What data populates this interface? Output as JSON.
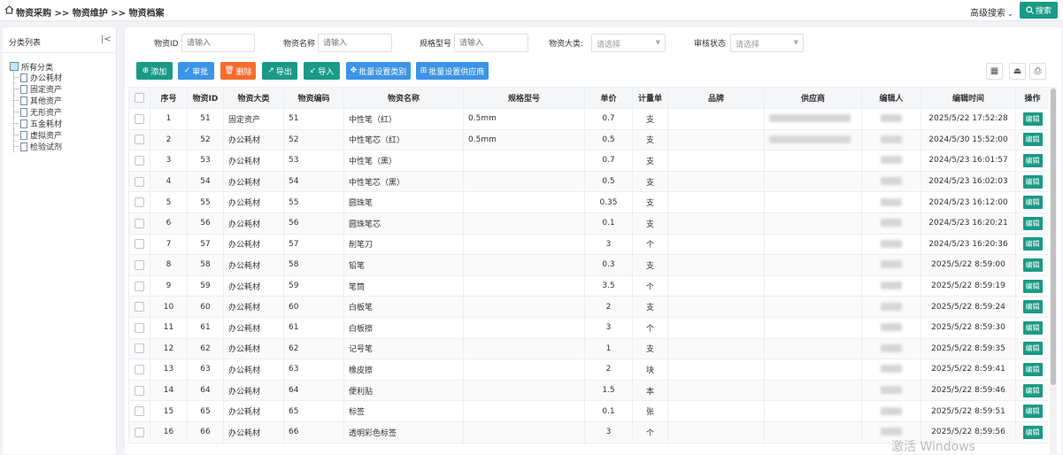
{
  "breadcrumb": "物资采购 >> 物资维护 >> 物资档案",
  "header": {
    "advanced_search": "高级搜索",
    "search_button": "搜索"
  },
  "sidebar": {
    "title": "分类列表",
    "root": "所有分类",
    "items": [
      {
        "label": "办公耗材"
      },
      {
        "label": "固定资产"
      },
      {
        "label": "其他资产"
      },
      {
        "label": "无形资产"
      },
      {
        "label": "五金耗材"
      },
      {
        "label": "虚拟资产"
      },
      {
        "label": "检验试剂"
      }
    ]
  },
  "filters": {
    "id_label": "物资ID",
    "id_placeholder": "请输入",
    "name_label": "物资名称",
    "name_placeholder": "请输入",
    "spec_label": "规格型号",
    "spec_placeholder": "请输入",
    "category_label": "物资大类:",
    "category_placeholder": "请选择",
    "status_label": "审核状态",
    "status_placeholder": "请选择"
  },
  "toolbar": {
    "add": "添加",
    "approve": "审批",
    "delete": "删除",
    "export": "导出",
    "import": "导入",
    "batch_category": "批量设置类别",
    "batch_supplier": "批量设置供应商"
  },
  "table": {
    "headers": [
      "序号",
      "物资ID",
      "物资大类",
      "物资编码",
      "物资名称",
      "规格型号",
      "单价",
      "计量单",
      "品牌",
      "供应商",
      "编辑人",
      "编辑时间",
      "操作"
    ],
    "edit_label": "编辑",
    "rows": [
      {
        "no": "1",
        "id": "51",
        "category": "固定资产",
        "code": "51",
        "name": "中性笔（红）",
        "spec": "0.5mm",
        "price": "0.7",
        "unit": "支",
        "time": "2025/5/22 17:52:28"
      },
      {
        "no": "2",
        "id": "52",
        "category": "办公耗材",
        "code": "52",
        "name": "中性笔芯（红）",
        "spec": "0.5mm",
        "price": "0.5",
        "unit": "支",
        "time": "2024/5/30 15:52:00"
      },
      {
        "no": "3",
        "id": "53",
        "category": "办公耗材",
        "code": "53",
        "name": "中性笔（黑）",
        "spec": "",
        "price": "0.7",
        "unit": "支",
        "time": "2024/5/23 16:01:57"
      },
      {
        "no": "4",
        "id": "54",
        "category": "办公耗材",
        "code": "54",
        "name": "中性笔芯（黑）",
        "spec": "",
        "price": "0.5",
        "unit": "支",
        "time": "2024/5/23 16:02:03"
      },
      {
        "no": "5",
        "id": "55",
        "category": "办公耗材",
        "code": "55",
        "name": "圆珠笔",
        "spec": "",
        "price": "0.35",
        "unit": "支",
        "time": "2024/5/23 16:12:00"
      },
      {
        "no": "6",
        "id": "56",
        "category": "办公耗材",
        "code": "56",
        "name": "圆珠笔芯",
        "spec": "",
        "price": "0.1",
        "unit": "支",
        "time": "2024/5/23 16:20:21"
      },
      {
        "no": "7",
        "id": "57",
        "category": "办公耗材",
        "code": "57",
        "name": "削笔刀",
        "spec": "",
        "price": "3",
        "unit": "个",
        "time": "2024/5/23 16:20:36"
      },
      {
        "no": "8",
        "id": "58",
        "category": "办公耗材",
        "code": "58",
        "name": "铅笔",
        "spec": "",
        "price": "0.3",
        "unit": "支",
        "time": "2025/5/22 8:59:00"
      },
      {
        "no": "9",
        "id": "59",
        "category": "办公耗材",
        "code": "59",
        "name": "笔筒",
        "spec": "",
        "price": "3.5",
        "unit": "个",
        "time": "2025/5/22 8:59:19"
      },
      {
        "no": "10",
        "id": "60",
        "category": "办公耗材",
        "code": "60",
        "name": "白板笔",
        "spec": "",
        "price": "2",
        "unit": "支",
        "time": "2025/5/22 8:59:24"
      },
      {
        "no": "11",
        "id": "61",
        "category": "办公耗材",
        "code": "61",
        "name": "白板擦",
        "spec": "",
        "price": "3",
        "unit": "个",
        "time": "2025/5/22 8:59:30"
      },
      {
        "no": "12",
        "id": "62",
        "category": "办公耗材",
        "code": "62",
        "name": "记号笔",
        "spec": "",
        "price": "1",
        "unit": "支",
        "time": "2025/5/22 8:59:35"
      },
      {
        "no": "13",
        "id": "63",
        "category": "办公耗材",
        "code": "63",
        "name": "橡皮擦",
        "spec": "",
        "price": "2",
        "unit": "块",
        "time": "2025/5/22 8:59:41"
      },
      {
        "no": "14",
        "id": "64",
        "category": "办公耗材",
        "code": "64",
        "name": "便利贴",
        "spec": "",
        "price": "1.5",
        "unit": "本",
        "time": "2025/5/22 8:59:46"
      },
      {
        "no": "15",
        "id": "65",
        "category": "办公耗材",
        "code": "65",
        "name": "标签",
        "spec": "",
        "price": "0.1",
        "unit": "张",
        "time": "2025/5/22 8:59:51"
      },
      {
        "no": "16",
        "id": "66",
        "category": "办公耗材",
        "code": "66",
        "name": "透明彩色标签",
        "spec": "",
        "price": "3",
        "unit": "个",
        "time": "2025/5/22 8:59:56"
      }
    ]
  },
  "watermark": "激活 Windows",
  "colors": {
    "teal": "#1a9a86",
    "blue": "#3b94e6",
    "orange": "#f56c2d"
  }
}
